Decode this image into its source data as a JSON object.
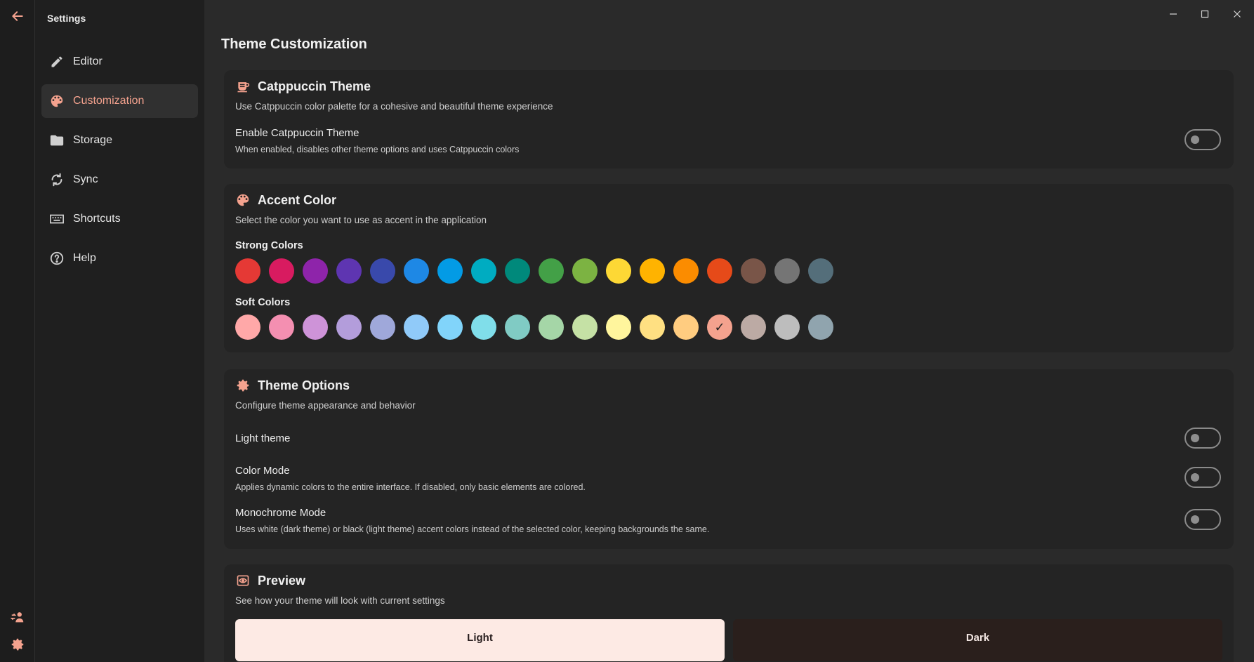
{
  "sidebar": {
    "title": "Settings",
    "items": [
      {
        "label": "Editor",
        "icon": "pencil-icon"
      },
      {
        "label": "Customization",
        "icon": "palette-icon"
      },
      {
        "label": "Storage",
        "icon": "folder-icon"
      },
      {
        "label": "Sync",
        "icon": "sync-icon"
      },
      {
        "label": "Shortcuts",
        "icon": "keyboard-icon"
      },
      {
        "label": "Help",
        "icon": "help-icon"
      }
    ],
    "active_index": 1
  },
  "page": {
    "title": "Theme Customization"
  },
  "catppuccin": {
    "title": "Catppuccin Theme",
    "desc": "Use Catppuccin color palette for a cohesive and beautiful theme experience",
    "toggle_label": "Enable Catppuccin Theme",
    "toggle_sub": "When enabled, disables other theme options and uses Catppuccin colors",
    "enabled": false
  },
  "accent": {
    "title": "Accent Color",
    "desc": "Select the color you want to use as accent in the application",
    "strong_label": "Strong Colors",
    "soft_label": "Soft Colors",
    "strong": [
      "#e53935",
      "#d81b60",
      "#8e24aa",
      "#5e35b1",
      "#3949ab",
      "#1e88e5",
      "#039be5",
      "#00acc1",
      "#00897b",
      "#43a047",
      "#7cb342",
      "#fdd835",
      "#ffb300",
      "#fb8c00",
      "#e64a19",
      "#795548",
      "#757575",
      "#546e7a"
    ],
    "soft": [
      "#ffa8a8",
      "#f48fb1",
      "#ce93d8",
      "#b39ddb",
      "#9fa8da",
      "#90caf9",
      "#81d4fa",
      "#80deea",
      "#80cbc4",
      "#a5d6a7",
      "#c5e1a5",
      "#fff59d",
      "#ffe082",
      "#ffcc80",
      "#f4a28e",
      "#bcaaa4",
      "#bdbdbd",
      "#90a4ae"
    ],
    "selected_soft_index": 14
  },
  "theme_options": {
    "title": "Theme Options",
    "desc": "Configure theme appearance and behavior",
    "light_label": "Light theme",
    "color_mode_label": "Color Mode",
    "color_mode_sub": "Applies dynamic colors to the entire interface. If disabled, only basic elements are colored.",
    "mono_label": "Monochrome Mode",
    "mono_sub": "Uses white (dark theme) or black (light theme) accent colors instead of the selected color, keeping backgrounds the same."
  },
  "preview": {
    "title": "Preview",
    "desc": "See how your theme will look with current settings",
    "light_label": "Light",
    "dark_label": "Dark"
  },
  "colors": {
    "accent": "#f4a28e",
    "background": "#2a2a2a",
    "card": "#242424"
  }
}
